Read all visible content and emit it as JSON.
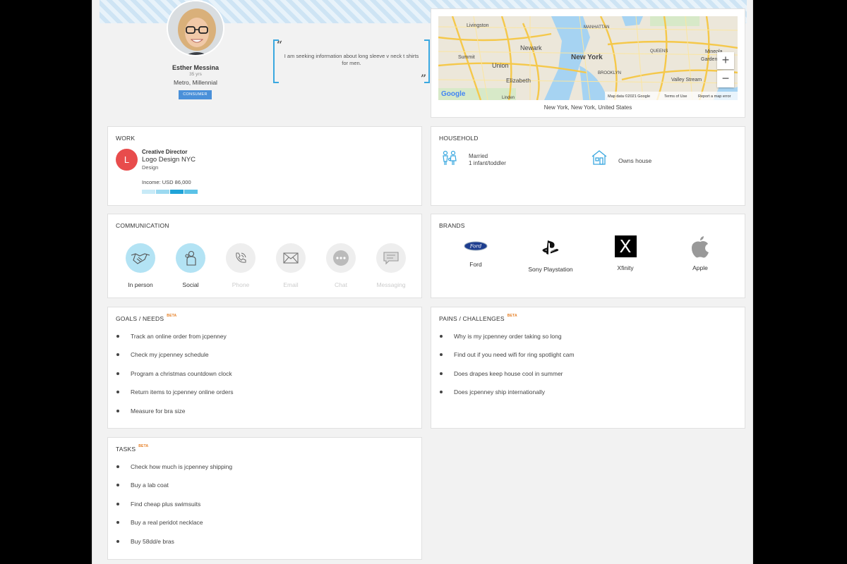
{
  "profile": {
    "name": "Esther Messina",
    "age": "35 yrs",
    "segment": "Metro, Millennial",
    "badge": "CONSUMER",
    "quote": "I am seeking information about long sleeve v neck t shirts for men."
  },
  "map": {
    "caption": "New York, New York, United States",
    "labels": [
      "Livingston",
      "Newark",
      "Union",
      "Summit",
      "Elizabeth",
      "New York",
      "MANHATTAN",
      "QUEENS",
      "BROOKLYN",
      "Mineola",
      "Garden City",
      "Valley Stream",
      "Linden"
    ],
    "attribution": "Map data ©2021 Google",
    "terms": "Terms of Use",
    "report": "Report a map error",
    "google": "Google",
    "zoom_in": "+",
    "zoom_out": "−"
  },
  "work": {
    "title": "WORK",
    "logo_letter": "L",
    "role": "Creative Director",
    "company": "Logo Design NYC",
    "industry": "Design",
    "income": "Income: USD 86,000",
    "income_level": 0.55
  },
  "household": {
    "title": "HOUSEHOLD",
    "family_line1": "Married",
    "family_line2": "1 infant/toddler",
    "home": "Owns house"
  },
  "communication": {
    "title": "COMMUNICATION",
    "channels": [
      {
        "label": "In person",
        "icon": "handshake-icon",
        "active": true
      },
      {
        "label": "Social",
        "icon": "social-icon",
        "active": true
      },
      {
        "label": "Phone",
        "icon": "phone-icon",
        "active": false
      },
      {
        "label": "Email",
        "icon": "envelope-icon",
        "active": false
      },
      {
        "label": "Chat",
        "icon": "chat-icon",
        "active": false
      },
      {
        "label": "Messaging",
        "icon": "message-icon",
        "active": false
      }
    ]
  },
  "brands": {
    "title": "BRANDS",
    "items": [
      {
        "label": "Ford",
        "icon": "ford-logo"
      },
      {
        "label": "Sony Playstation",
        "icon": "playstation-logo"
      },
      {
        "label": "Xfinity",
        "icon": "xfinity-logo",
        "letter": "X"
      },
      {
        "label": "Apple",
        "icon": "apple-logo"
      }
    ]
  },
  "goals": {
    "title": "GOALS / NEEDS",
    "beta": "BETA",
    "items": [
      "Track an online order from jcpenney",
      "Check my jcpenney schedule",
      "Program a christmas countdown clock",
      "Return items to jcpenney online orders",
      "Measure for bra size"
    ]
  },
  "pains": {
    "title": "PAINS / CHALLENGES",
    "beta": "BETA",
    "items": [
      "Why is my jcpenney order taking so long",
      "Find out if you need wifi for ring spotlight cam",
      "Does drapes keep house cool in summer",
      "Does jcpenney ship internationally"
    ]
  },
  "tasks": {
    "title": "TASKS",
    "beta": "BETA",
    "items": [
      "Check how much is jcpenney shipping",
      "Buy a lab coat",
      "Find cheap plus swimsuits",
      "Buy a real peridot necklace",
      "Buy 58dd/e bras"
    ]
  },
  "colors": {
    "accent": "#3aa8e0",
    "badge": "#4a90d9",
    "work_logo": "#e84c4c",
    "beta": "#e67e22",
    "active_channel": "#b3e3f4",
    "inactive_channel": "#eeeeee"
  }
}
